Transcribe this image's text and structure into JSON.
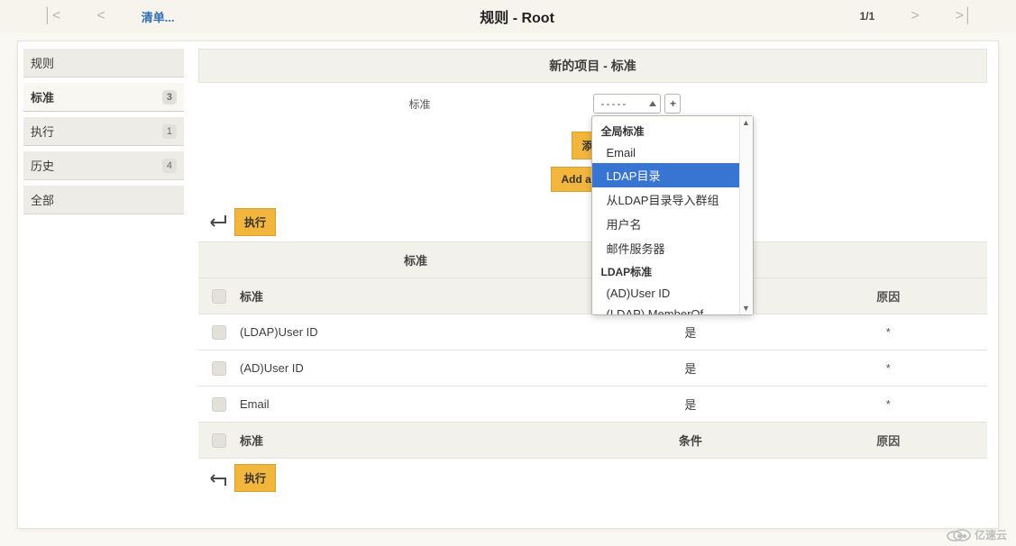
{
  "pager": {
    "list_link": "清单...",
    "title": "规则 - Root",
    "count": "1/1"
  },
  "sidebar": {
    "tabs": [
      {
        "label": "规则",
        "badge": "",
        "active": false
      },
      {
        "label": "标准",
        "badge": "3",
        "active": true
      },
      {
        "label": "执行",
        "badge": "1",
        "active": false
      },
      {
        "label": "历史",
        "badge": "4",
        "active": false
      },
      {
        "label": "全部",
        "badge": "",
        "active": false
      }
    ]
  },
  "section": {
    "title": "新的项目 - 标准",
    "field_label": "标准",
    "select_value": "-----",
    "add_label": "添加",
    "add_new_label": "Add a new c"
  },
  "exec_label": "执行",
  "table": {
    "head": {
      "col_std": "标准",
      "col_cond": "条件",
      "col_reason": "原因"
    },
    "top_extra_head": "标准",
    "rows": [
      {
        "std": "(LDAP)User ID",
        "cond": "是",
        "reason": "*"
      },
      {
        "std": "(AD)User ID",
        "cond": "是",
        "reason": "*"
      },
      {
        "std": "Email",
        "cond": "是",
        "reason": "*"
      }
    ]
  },
  "dropdown": {
    "groups": [
      {
        "title": "全局标准",
        "items": [
          "Email",
          "LDAP目录",
          "从LDAP目录导入群组",
          "用户名",
          "邮件服务器"
        ]
      },
      {
        "title": "LDAP标准",
        "items": [
          "(AD)User ID",
          "(LDAP) MemberOf"
        ]
      }
    ],
    "highlight": "LDAP目录"
  },
  "watermark": "亿速云"
}
